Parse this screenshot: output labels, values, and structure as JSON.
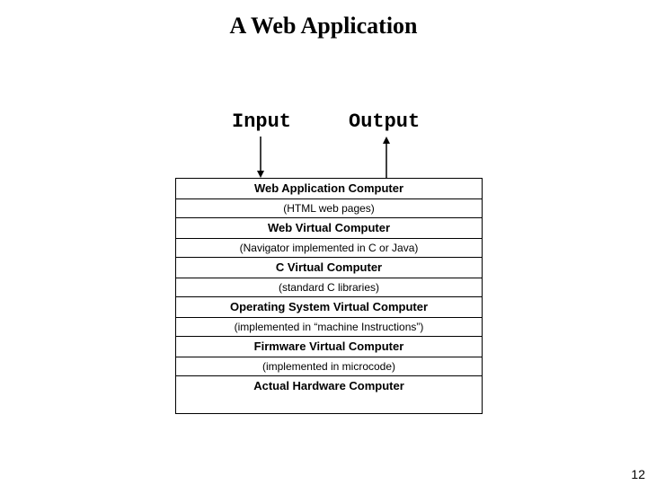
{
  "title": "A Web Application",
  "io": {
    "input": "Input",
    "output": "Output"
  },
  "layers": [
    {
      "head": "Web Application Computer",
      "sub": "(HTML web pages)"
    },
    {
      "head": "Web Virtual Computer",
      "sub": "(Navigator implemented in C or Java)"
    },
    {
      "head": "C Virtual Computer",
      "sub": "(standard C libraries)"
    },
    {
      "head": "Operating System Virtual Computer",
      "sub": "(implemented in “machine Instructions”)"
    },
    {
      "head": "Firmware Virtual Computer",
      "sub": "(implemented in microcode)"
    },
    {
      "head": "Actual Hardware Computer",
      "sub": null
    }
  ],
  "page_number": "12"
}
